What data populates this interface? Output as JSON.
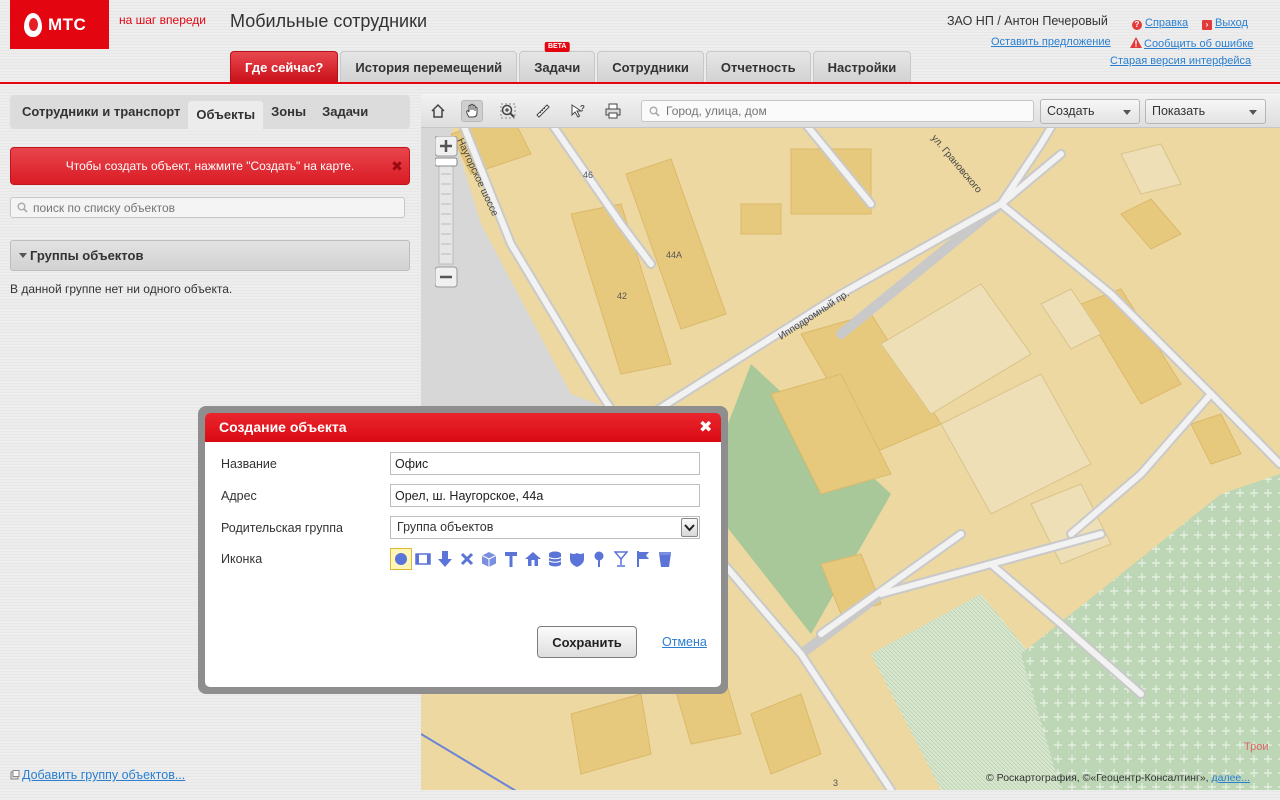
{
  "header": {
    "logo_text": "МТС",
    "slogan": "на шаг впереди",
    "app_title": "Мобильные сотрудники",
    "user": "ЗАО НП / Антон Печеровый",
    "links": {
      "help": "Справка",
      "logout": "Выход",
      "suggest": "Оставить предложение",
      "report_error": "Сообщить об ошибке",
      "old_version": "Старая версия интерфейса"
    },
    "brand_color": "#e30611"
  },
  "nav": {
    "tabs": [
      {
        "label": "Где сейчас?",
        "active": true
      },
      {
        "label": "История перемещений"
      },
      {
        "label": "Задачи",
        "badge": "BETA"
      },
      {
        "label": "Сотрудники"
      },
      {
        "label": "Отчетность"
      },
      {
        "label": "Настройки"
      }
    ]
  },
  "left": {
    "tabs": [
      "Сотрудники и транспорт",
      "Объекты",
      "Зоны",
      "Задачи"
    ],
    "active_tab": "Объекты",
    "hint": "Чтобы создать объект, нажмите \"Создать\" на карте.",
    "search_placeholder": "поиск по списку объектов",
    "groups_header": "Группы объектов",
    "groups_empty": "В данной группе нет ни одного объекта.",
    "add_group": "Добавить группу объектов..."
  },
  "map": {
    "search_placeholder": "Город, улица, дом",
    "create_label": "Создать",
    "show_label": "Показать",
    "streets": {
      "naugorskoe": "Наугорское шоссе",
      "granovskogo": "ул. Грановского",
      "ippodromny": "Ипподромный пр."
    },
    "house_numbers": [
      "46",
      "44А",
      "42",
      "3"
    ],
    "troy_label": "Трои",
    "attribution": "© Роскартография, ©«Геоцентр-Консалтинг»,",
    "attribution_link": "далее..."
  },
  "modal": {
    "title": "Создание объекта",
    "fields": {
      "name_label": "Название",
      "name_value": "Офис",
      "address_label": "Адрес",
      "address_value": "Орел, ш. Наугорское, 44а",
      "group_label": "Родительская группа",
      "group_value": "Группа объектов",
      "icon_label": "Иконка"
    },
    "icons": [
      "circle",
      "film",
      "arrow-down",
      "cross",
      "cube",
      "hammer",
      "house",
      "stack",
      "shield",
      "pin",
      "glass",
      "flag",
      "cup"
    ],
    "selected_icon": "circle",
    "save": "Сохранить",
    "cancel": "Отмена"
  }
}
